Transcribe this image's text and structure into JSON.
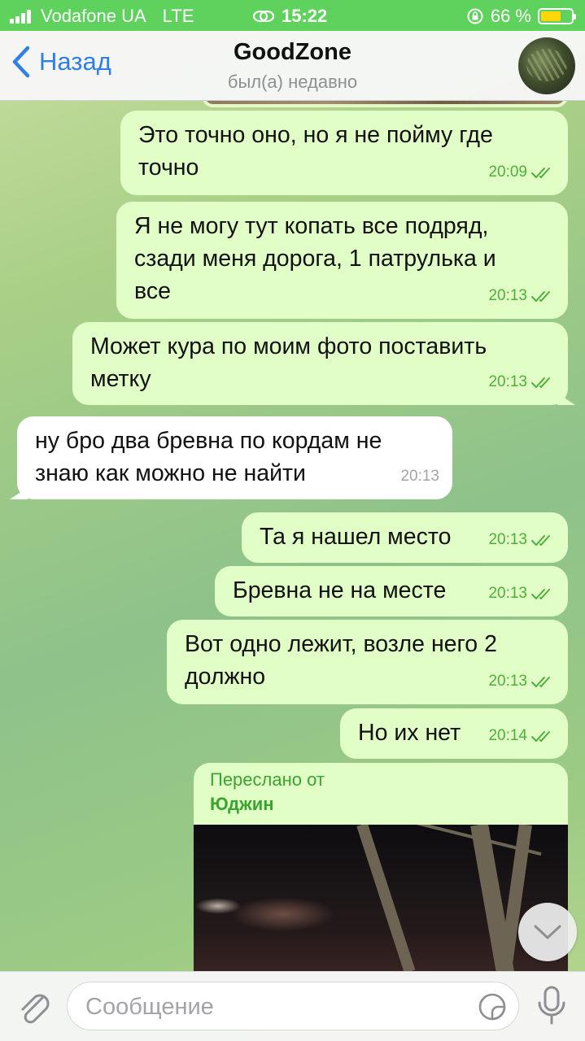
{
  "status_bar": {
    "carrier": "Vodafone UA",
    "network": "LTE",
    "time": "15:22",
    "battery": "66 %",
    "battery_level": 0.66
  },
  "header": {
    "back_label": "Назад",
    "title": "GoodZone",
    "subtitle": "был(а) недавно"
  },
  "messages": [
    {
      "dir": "out",
      "text_lines": [
        "Это точно оно, но я не пойму где",
        "точно"
      ],
      "time": "20:09"
    },
    {
      "dir": "out",
      "text_lines": [
        "Я не могу тут копать все подряд,",
        "сзади меня дорога, 1 патрулька и",
        "все"
      ],
      "time": "20:13"
    },
    {
      "dir": "out",
      "text_lines": [
        "Может кура по моим фото поставить",
        "метку"
      ],
      "time": "20:13"
    },
    {
      "dir": "in",
      "text_lines": [
        "ну бро два бревна по кордам не",
        "знаю как можно не найти"
      ],
      "time": "20:13"
    },
    {
      "dir": "out",
      "text_lines": [
        "Та я нашел место"
      ],
      "time": "20:13"
    },
    {
      "dir": "out",
      "text_lines": [
        "Бревна не на месте"
      ],
      "time": "20:13"
    },
    {
      "dir": "out",
      "text_lines": [
        "Вот одно лежит, возле него 2",
        "должно"
      ],
      "time": "20:13"
    },
    {
      "dir": "out",
      "text_lines": [
        "Но их нет"
      ],
      "time": "20:14"
    }
  ],
  "forwarded": {
    "label": "Переслано от",
    "sender": "Юджин"
  },
  "input": {
    "placeholder": "Сообщение"
  },
  "colors": {
    "outgoing_bubble": "#e1fec6",
    "incoming_bubble": "#ffffff",
    "status_bar": "#5ed25c",
    "accent_blue": "#2f7fe6",
    "check_green": "#4fae3a"
  }
}
